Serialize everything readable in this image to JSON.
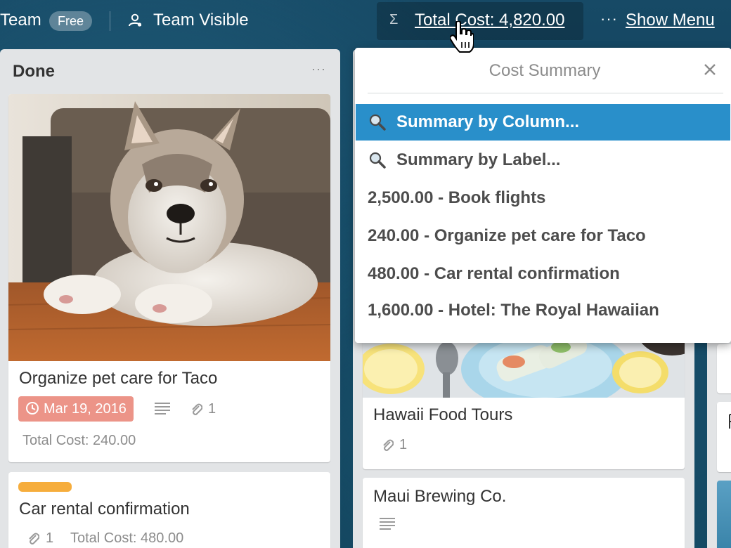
{
  "header": {
    "team_name": "Team",
    "plan_badge": "Free",
    "visibility_label": "Team Visible",
    "total_cost_label": "Total Cost: 4,820.00",
    "sigma_symbol": "Σ",
    "more_symbol": "···",
    "show_menu_label": "Show Menu"
  },
  "lists": {
    "done": {
      "title": "Done",
      "menu_symbol": "···",
      "cards": [
        {
          "title": "Organize pet care for Taco",
          "due_date": "Mar 19, 2016",
          "attachments": "1",
          "total_cost": "Total Cost: 240.00"
        },
        {
          "label_color": "#f6ad3c",
          "title": "Car rental confirmation",
          "attachments": "1",
          "total_cost": "Total Cost: 480.00"
        }
      ]
    },
    "middle": {
      "cards": [
        {
          "title": "Hawaii Food Tours",
          "attachments": "1"
        },
        {
          "title": "Maui Brewing Co."
        }
      ]
    }
  },
  "cost_summary": {
    "title": "Cost Summary",
    "items": [
      {
        "label": "Summary by Column...",
        "icon": "magnifier-icon",
        "active": true
      },
      {
        "label": "Summary by Label...",
        "icon": "magnifier-icon",
        "active": false
      },
      {
        "label": "2,500.00 - Book flights"
      },
      {
        "label": "240.00 - Organize pet care for Taco"
      },
      {
        "label": "480.00 - Car rental confirmation"
      },
      {
        "label": "1,600.00 - Hotel: The Royal Hawaiian"
      }
    ]
  },
  "colors": {
    "accent_blue": "#298fca",
    "due_badge": "#ec9488",
    "list_background": "#e2e4e6"
  }
}
